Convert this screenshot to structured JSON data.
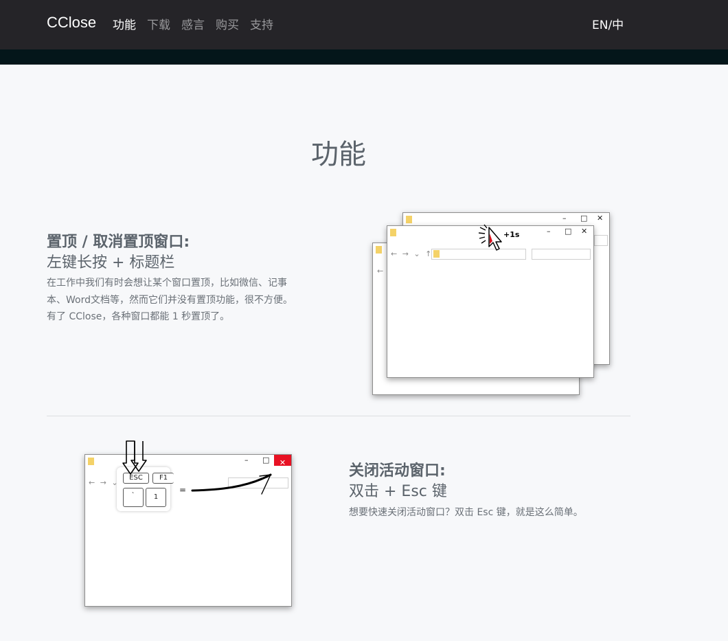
{
  "navbar": {
    "brand": "CClose",
    "links": [
      "功能",
      "下载",
      "感言",
      "购买",
      "支持"
    ],
    "lang": "EN/中"
  },
  "section": {
    "title": "功能"
  },
  "features": [
    {
      "title": "置顶 / 取消置顶窗口:",
      "subtitle": "左键长按 + 标题栏",
      "desc_lines": [
        "在工作中我们有时会想让某个窗口置顶，比如微信、记事",
        "本、Word文档等，然而它们并没有置顶功能，很不方便。",
        "有了 CClose，各种窗口都能 1 秒置顶了。"
      ]
    },
    {
      "title": "关闭活动窗口:",
      "subtitle": "双击 + Esc 键",
      "desc_lines": [
        "想要快速关闭活动窗口？双击 Esc 键，就是这么简单。"
      ]
    }
  ],
  "illustration1": {
    "badge": "+1s"
  },
  "illustration2": {
    "keys": [
      "ESC",
      "F1",
      "`",
      "1"
    ],
    "equals": "="
  },
  "colors": {
    "navbar": "#252428",
    "accent_red": "#e81123",
    "folder": "#f4d268"
  }
}
